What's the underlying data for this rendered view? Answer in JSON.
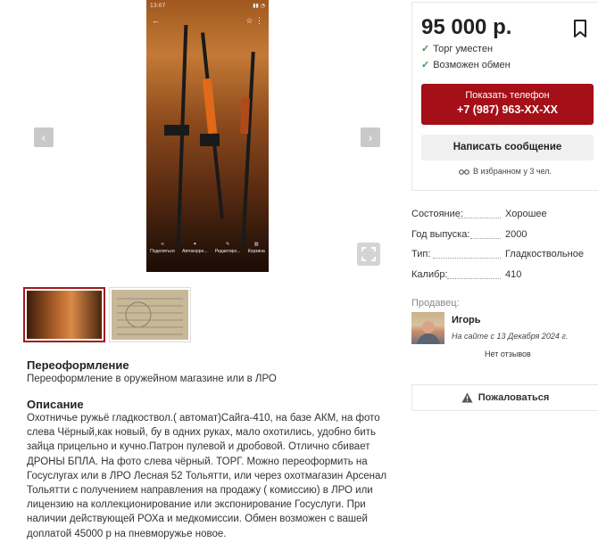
{
  "gallery": {
    "phone_status_time": "13:07",
    "phone_actions": [
      {
        "icon": "share-icon",
        "label": "Поделиться"
      },
      {
        "icon": "auto-correct-icon",
        "label": "Автокорре..."
      },
      {
        "icon": "edit-icon",
        "label": "Редактиро..."
      },
      {
        "icon": "trash-icon",
        "label": "Корзина"
      }
    ]
  },
  "listing": {
    "price": "95 000 р.",
    "perks": [
      "Торг уместен",
      "Возможен обмен"
    ],
    "phone_button_label": "Показать телефон",
    "phone_number": "+7 (987) 963-XX-XX",
    "message_button_label": "Написать сообщение",
    "favorites_note": "В избранном у 3 чел."
  },
  "params": [
    {
      "key": "Состояние:",
      "value": "Хорошее"
    },
    {
      "key": "Год выпуска:",
      "value": "2000"
    },
    {
      "key": "Тип:",
      "value": "Гладкоствольное"
    },
    {
      "key": "Калибр:",
      "value": "410"
    }
  ],
  "seller": {
    "label": "Продавец:",
    "name": "Игорь",
    "since": "На сайте с 13 Декабря 2024 г.",
    "reviews": "Нет отзывов"
  },
  "report_label": "Пожаловаться",
  "reregistration": {
    "title": "Переоформление",
    "text": "Переоформление в оружейном магазине или в ЛРО"
  },
  "description": {
    "title": "Описание",
    "lines": [
      "Охотничье ружьё гладкоствол.( автомат)Сайга-410, на базе АКМ, на фото",
      "слева Чёрный,как новый, бу в одних руках, мало охотились, удобно бить",
      "зайца прицельно и кучно.Патрон пулевой и дробовой. Отлично сбивает",
      "ДРОНЫ БПЛА. На фото слева чёрный. ТОРГ. Можно переоформить на",
      "Госуслугах или в ЛРО Лесная 52 Тольятти, или через охотмагазин Арсенал",
      "Тольятти с получением направления на продажу ( комиссию) в ЛРО или",
      "лицензию на коллекционирование или экспонирование Госуслуги. При",
      "наличии действующей РОХа и медкомиссии. Обмен возможен с вашей",
      "доплатой 45000 р на пневморужье новое."
    ]
  }
}
